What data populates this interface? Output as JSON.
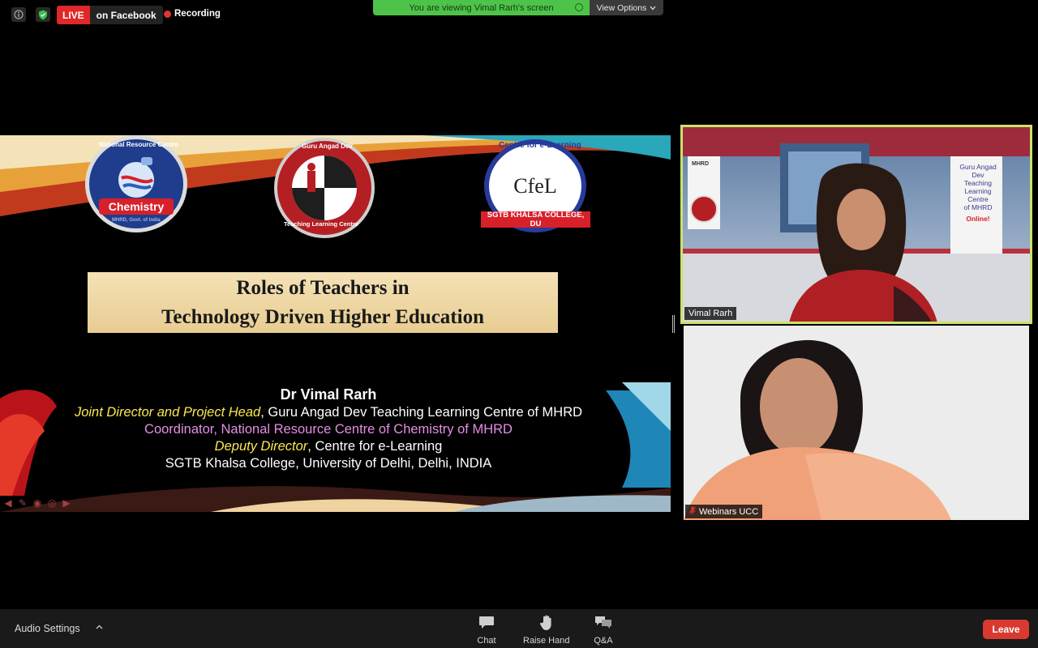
{
  "topbar": {
    "live_label": "LIVE",
    "stream_target": "on Facebook",
    "recording_label": "Recording",
    "viewing_banner": "You are viewing Vimal Rarh's screen",
    "view_options_label": "View Options"
  },
  "slide": {
    "logos": {
      "chemistry_arc": "National Resource Centre",
      "chemistry_ribbon": "Chemistry",
      "chemistry_sub": "MHRD, Govt. of India",
      "gurn_arc_top": "Guru Angad Dev",
      "gurn_arc_bottom": "Teaching Learning Centre",
      "cfel_arc": "Centre for e-Learning",
      "cfel_center": "CfeL",
      "cfel_ribbon": "SGTB KHALSA COLLEGE, DU"
    },
    "title_line1": "Roles of Teachers in",
    "title_line2": "Technology Driven Higher Education",
    "presenter_name": "Dr Vimal Rarh",
    "line1_role": "Joint Director and Project Head",
    "line1_rest": ", Guru Angad Dev Teaching Learning Centre of MHRD",
    "line2": "Coordinator, National Resource Centre of Chemistry of MHRD",
    "line3_role": "Deputy Director",
    "line3_rest": ", Centre for e-Learning",
    "line4": "SGTB Khalsa College, University of Delhi, Delhi, INDIA"
  },
  "videos": [
    {
      "label": "Vimal Rarh",
      "background_text": [
        "Guru Angad Dev",
        "Teaching Learning",
        "Centre",
        "of MHRD",
        "Online!"
      ],
      "mhrd_text": "MHRD"
    },
    {
      "label": "Webinars UCC",
      "muted": true
    }
  ],
  "toolbar": {
    "audio_settings": "Audio Settings",
    "chat": "Chat",
    "raise_hand": "Raise Hand",
    "qa": "Q&A",
    "leave": "Leave"
  },
  "colors": {
    "live_red": "#e02828",
    "banner_green": "#4ec34a",
    "leave_red": "#d93a2f",
    "active_speaker_border": "#c9e36a"
  }
}
